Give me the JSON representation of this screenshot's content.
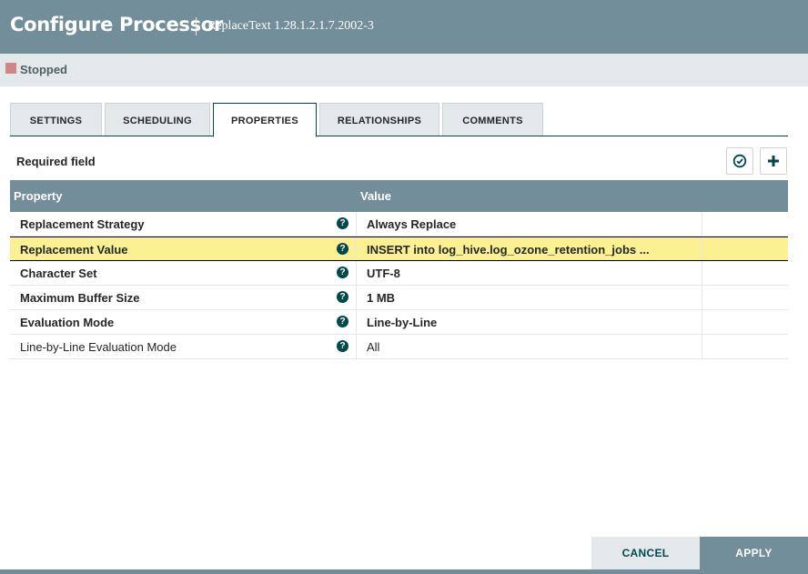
{
  "header": {
    "title": "Configure Processor",
    "subtitle": "ReplaceText 1.28.1.2.1.7.2002-3"
  },
  "status": {
    "label": "Stopped",
    "color": "#d18686"
  },
  "tabs": [
    {
      "label": "SETTINGS",
      "active": false
    },
    {
      "label": "SCHEDULING",
      "active": false
    },
    {
      "label": "PROPERTIES",
      "active": true
    },
    {
      "label": "RELATIONSHIPS",
      "active": false
    },
    {
      "label": "COMMENTS",
      "active": false
    }
  ],
  "required_field_label": "Required field",
  "icons": {
    "verify": "check-circle-icon",
    "add": "plus-icon",
    "help": "question-circle-icon"
  },
  "grid": {
    "headers": {
      "property": "Property",
      "value": "Value"
    },
    "rows": [
      {
        "property": "Replacement Strategy",
        "value": "Always Replace",
        "required": true,
        "selected": false
      },
      {
        "property": "Replacement Value",
        "value": "INSERT into log_hive.log_ozone_retention_jobs  ...",
        "required": true,
        "selected": true
      },
      {
        "property": "Character Set",
        "value": "UTF-8",
        "required": true,
        "selected": false
      },
      {
        "property": "Maximum Buffer Size",
        "value": "1 MB",
        "required": true,
        "selected": false
      },
      {
        "property": "Evaluation Mode",
        "value": "Line-by-Line",
        "required": true,
        "selected": false
      },
      {
        "property": "Line-by-Line Evaluation Mode",
        "value": "All",
        "required": false,
        "selected": false
      }
    ]
  },
  "buttons": {
    "cancel": "CANCEL",
    "apply": "APPLY"
  },
  "colors": {
    "header": "#728e9b",
    "accent": "#004849",
    "selected_row": "#fcf192",
    "status_bar": "#e3e8eb"
  }
}
